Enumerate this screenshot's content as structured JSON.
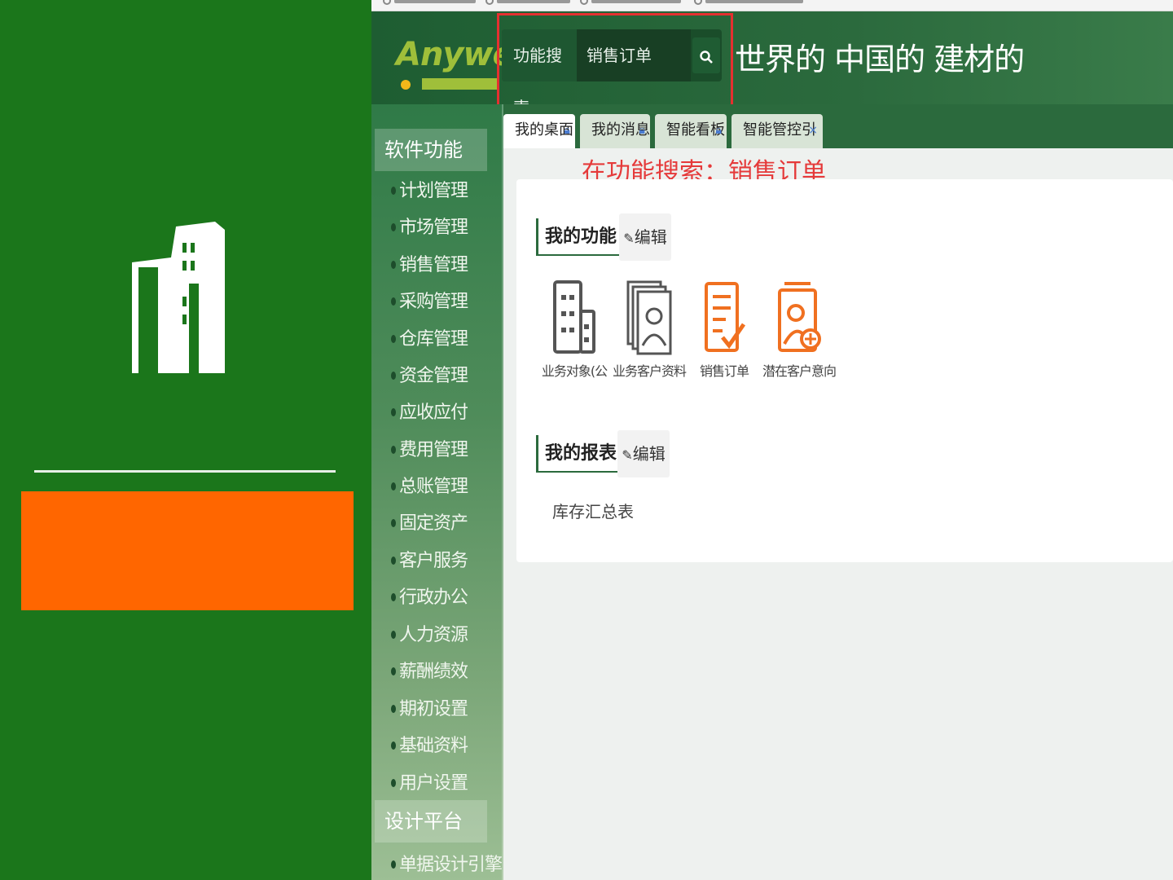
{
  "header": {
    "logo": "Anywell",
    "search_type": "功能搜索",
    "search_value": "销售订单",
    "slogan": "世界的 中国的 建材的"
  },
  "sidebar": {
    "sections": [
      {
        "label": "软件功能"
      },
      {
        "label": "设计平台"
      }
    ],
    "items": [
      {
        "label": "计划管理"
      },
      {
        "label": "市场管理"
      },
      {
        "label": "销售管理"
      },
      {
        "label": "采购管理"
      },
      {
        "label": "仓库管理"
      },
      {
        "label": "资金管理"
      },
      {
        "label": "应收应付"
      },
      {
        "label": "费用管理"
      },
      {
        "label": "总账管理"
      },
      {
        "label": "固定资产"
      },
      {
        "label": "客户服务"
      },
      {
        "label": "行政办公"
      },
      {
        "label": "人力资源"
      },
      {
        "label": "薪酬绩效"
      },
      {
        "label": "期初设置"
      },
      {
        "label": "基础资料"
      },
      {
        "label": "用户设置"
      }
    ],
    "design_items": [
      {
        "label": "单据设计引擎"
      }
    ]
  },
  "tabs": [
    {
      "label": "我的桌面"
    },
    {
      "label": "我的消息"
    },
    {
      "label": "智能看板"
    },
    {
      "label": "智能管控引擎"
    }
  ],
  "annotation": "在功能搜索：销售订单",
  "my_functions": {
    "title": "我的功能",
    "edit_label": "编辑",
    "apps": [
      {
        "label": "业务对象(公",
        "icon": "building-icon"
      },
      {
        "label": "业务客户资料",
        "icon": "contact-card-icon"
      },
      {
        "label": "销售订单",
        "icon": "order-checklist-icon"
      },
      {
        "label": "潜在客户意向",
        "icon": "add-customer-icon"
      }
    ]
  },
  "my_reports": {
    "title": "我的报表",
    "edit_label": "编辑",
    "items": [
      {
        "label": "库存汇总表"
      }
    ]
  },
  "colors": {
    "slide_green": "#1b761b",
    "accent_orange": "#ff6600",
    "header_green": "#2b6a3d",
    "highlight_red": "#e53030"
  }
}
